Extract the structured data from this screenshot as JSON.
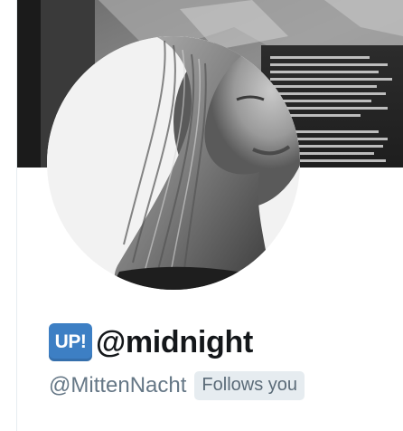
{
  "profile": {
    "badge_text": "UP!",
    "display_name": "@midnight",
    "handle": "@MittenNacht",
    "follows_you_label": "Follows you"
  },
  "banner": {
    "description": ""
  },
  "colors": {
    "badge": "#3d7fc4",
    "name": "#14171a",
    "handle": "#657786",
    "follows_bg": "#e6ecf0"
  }
}
